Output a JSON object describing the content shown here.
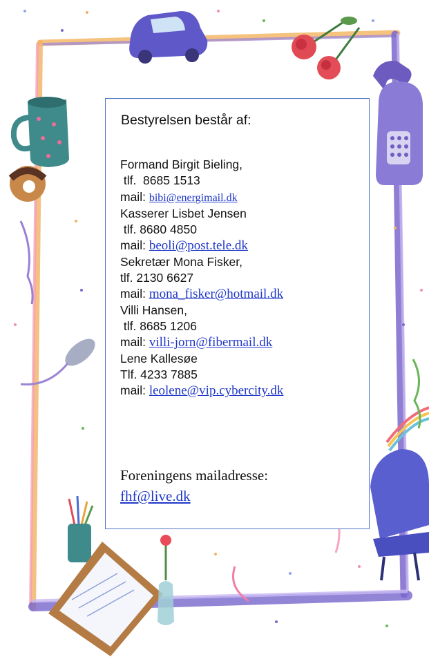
{
  "card": {
    "heading": "Bestyrelsen består af:",
    "members": [
      {
        "name_line": "Formand Birgit Bieling,",
        "phone_line": " tlf.  8685 1513",
        "mail_label": "mail: ",
        "email": "bibi@energimail.dk"
      },
      {
        "name_line": "Kasserer Lisbet Jensen",
        "phone_line": " tlf. 8680 4850",
        "mail_label": "mail: ",
        "email": "beoli@post.tele.dk"
      },
      {
        "name_line": "Sekretær Mona Fisker,",
        "phone_line": "tlf. 2130 6627",
        "mail_label": "mail: ",
        "email": "mona_fisker@hotmail.dk"
      },
      {
        "name_line": "Villi Hansen,",
        "phone_line": " tlf. 8685 1206",
        "mail_label": "mail: ",
        "email": "villi-jorn@fibermail.dk"
      },
      {
        "name_line": "Lene Kallesøe",
        "phone_line": "Tlf. 4233 7885",
        "mail_label": "mail: ",
        "email": "leolene@vip.cybercity.dk"
      }
    ],
    "association_label": "Foreningens mailadresse:",
    "association_email": "fhf@live.dk"
  },
  "colors": {
    "frame_purple": "#7a63c8",
    "frame_orange": "#f2b25a",
    "frame_pink": "#f08fb0",
    "link_blue": "#1f37c8",
    "card_border": "#4f74c8"
  },
  "decorations": [
    "car-icon",
    "roses-icon",
    "telephone-icon",
    "mug-icon",
    "donut-icon",
    "mouse-icon",
    "chair-icon",
    "pencil-cup-icon",
    "clipboard-icon",
    "flower-vase-icon",
    "ribbon-icon",
    "confetti"
  ]
}
